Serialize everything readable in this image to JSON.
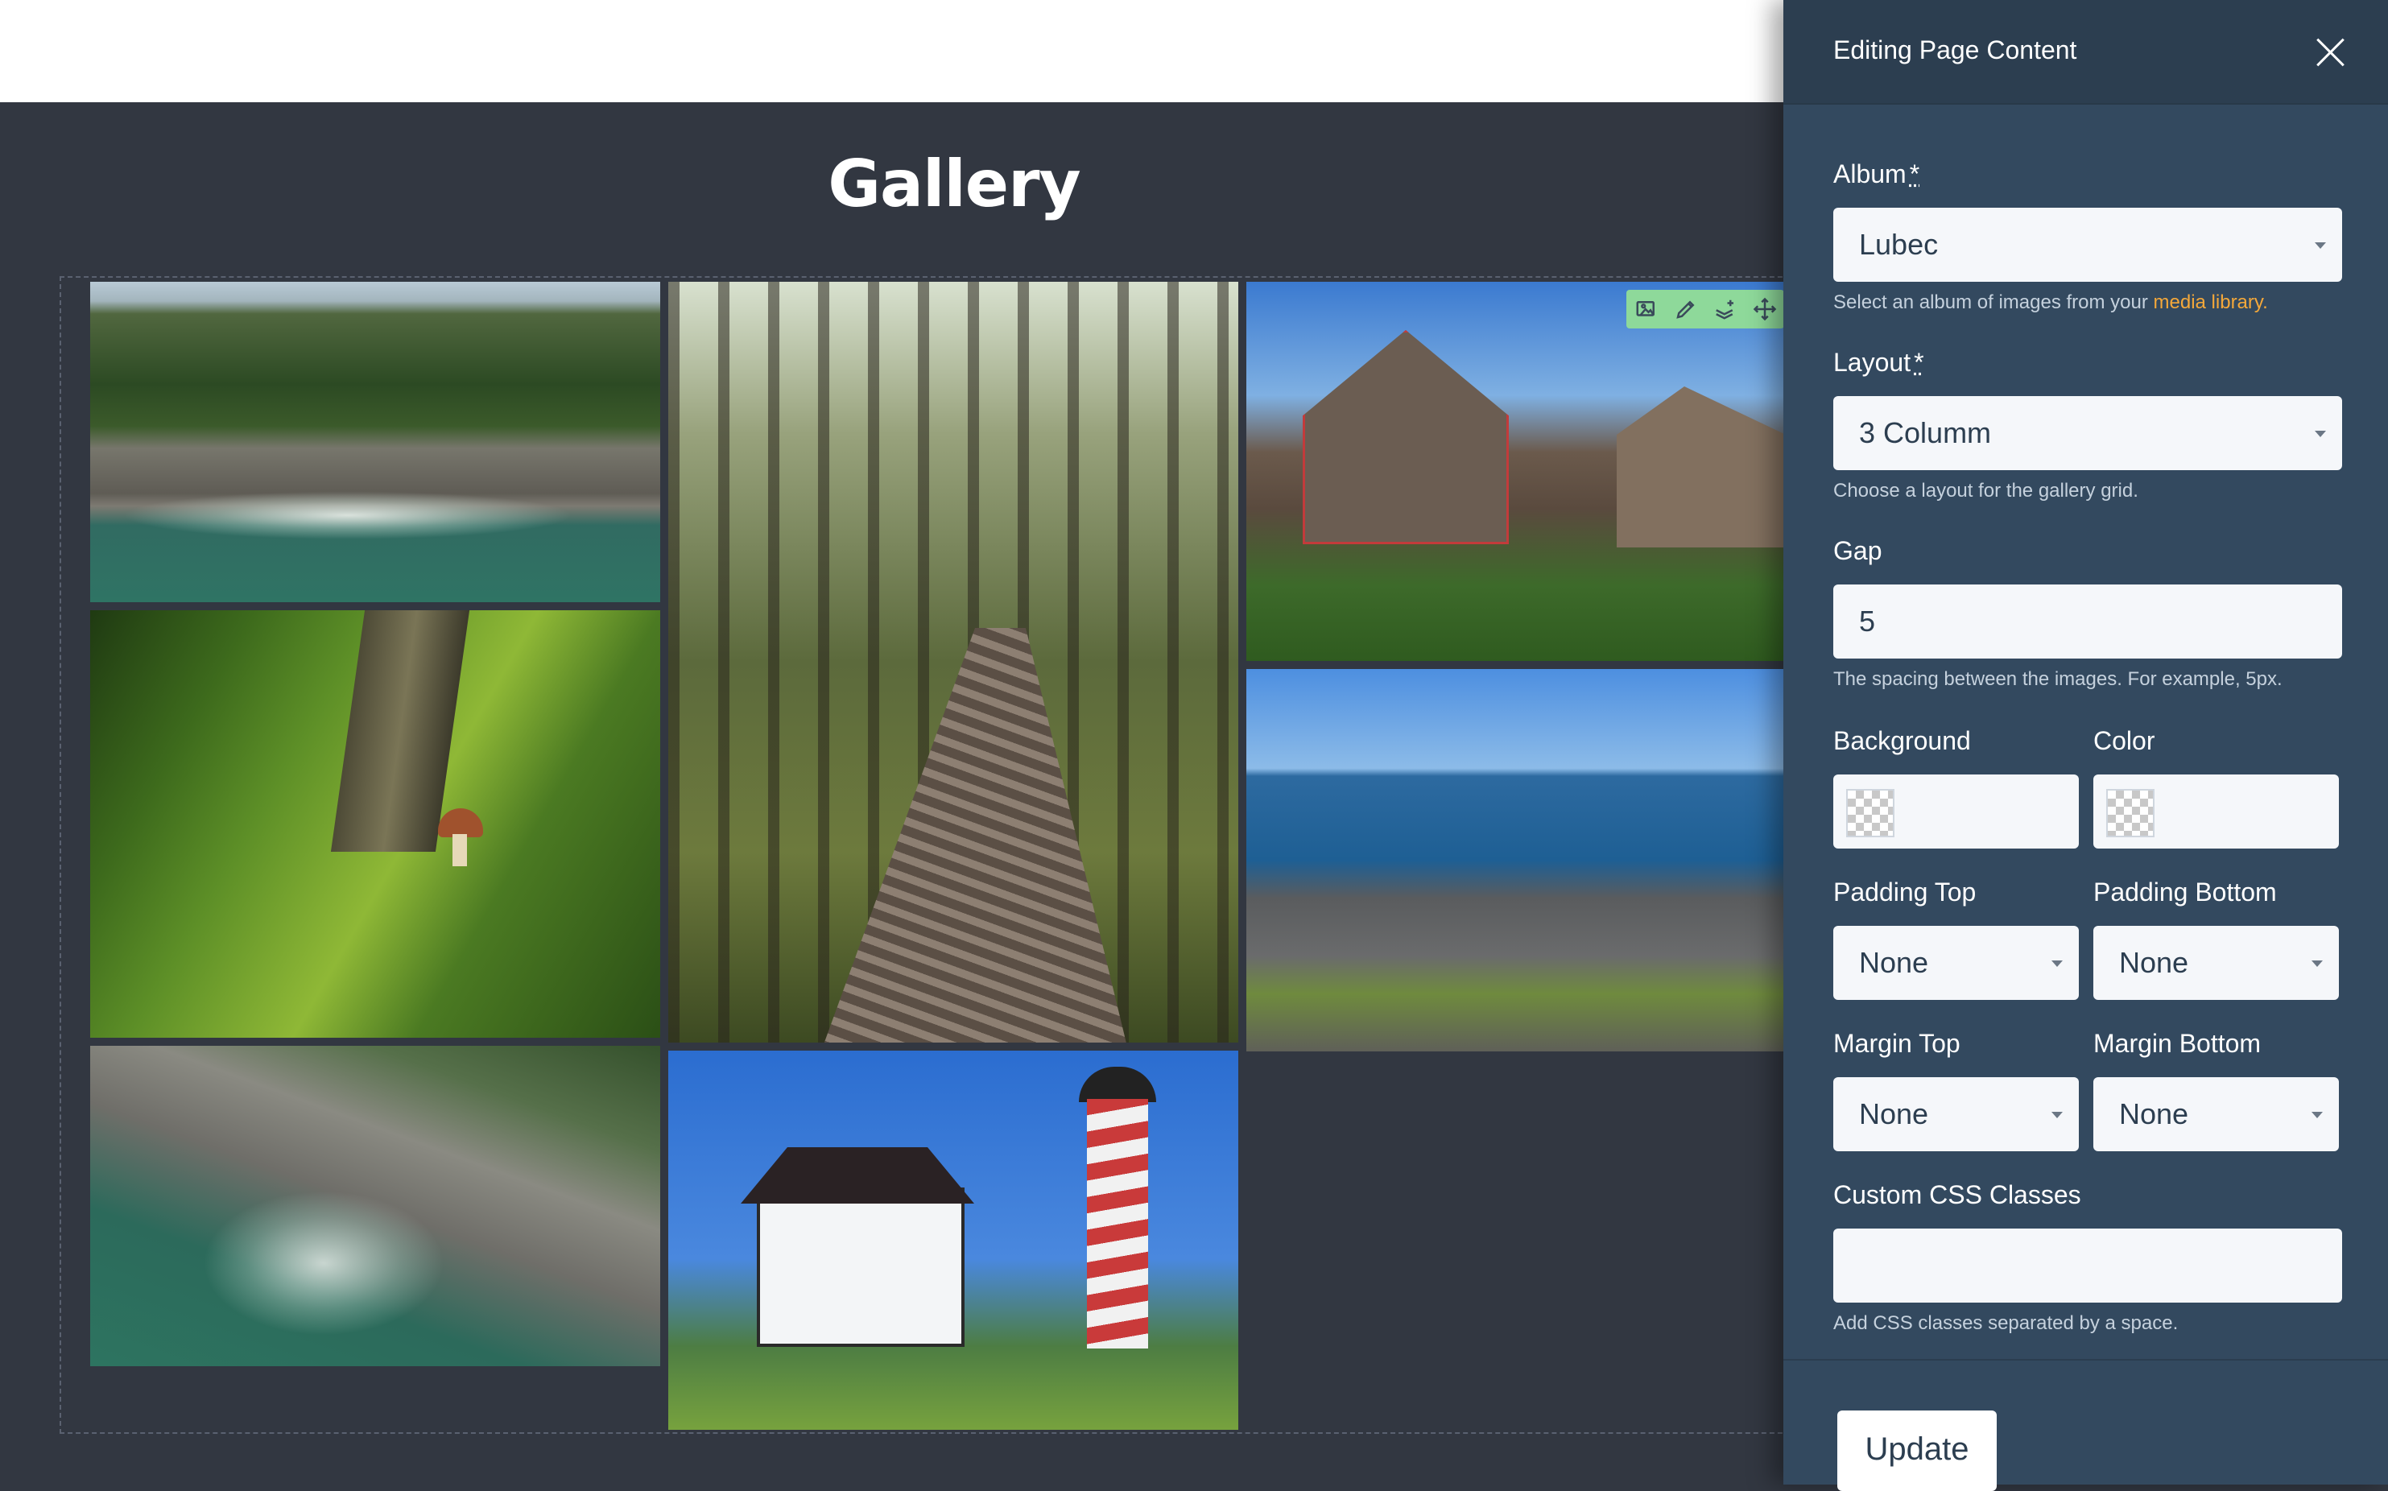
{
  "page": {
    "title": "Gallery"
  },
  "toolbar": {
    "icons": [
      "image-icon",
      "pencil-icon",
      "layers-add-icon",
      "move-icon"
    ]
  },
  "panel": {
    "title": "Editing Page Content",
    "album": {
      "label": "Album",
      "required_mark": "*",
      "value": "Lubec",
      "help": "Select an album of images from your ",
      "help_link": "media library."
    },
    "layout": {
      "label": "Layout",
      "required_mark": "*",
      "value": "3 Columm",
      "help": "Choose a layout for the gallery grid."
    },
    "gap": {
      "label": "Gap",
      "value": "5",
      "help": "The spacing between the images. For example, 5px."
    },
    "background": {
      "label": "Background",
      "value": ""
    },
    "color": {
      "label": "Color",
      "value": ""
    },
    "padding_top": {
      "label": "Padding Top",
      "value": "None"
    },
    "padding_bottom": {
      "label": "Padding Bottom",
      "value": "None"
    },
    "margin_top": {
      "label": "Margin Top",
      "value": "None"
    },
    "margin_bottom": {
      "label": "Margin Bottom",
      "value": "None"
    },
    "custom_css": {
      "label": "Custom CSS Classes",
      "value": "",
      "help": "Add CSS classes separated by a space."
    },
    "update_label": "Update"
  },
  "colors": {
    "page_bg": "#323741",
    "panel_bg": "#33495f",
    "panel_header_bg": "#2c3e50",
    "link": "#f4a83a",
    "toolbar_bg": "#8ed99a"
  }
}
